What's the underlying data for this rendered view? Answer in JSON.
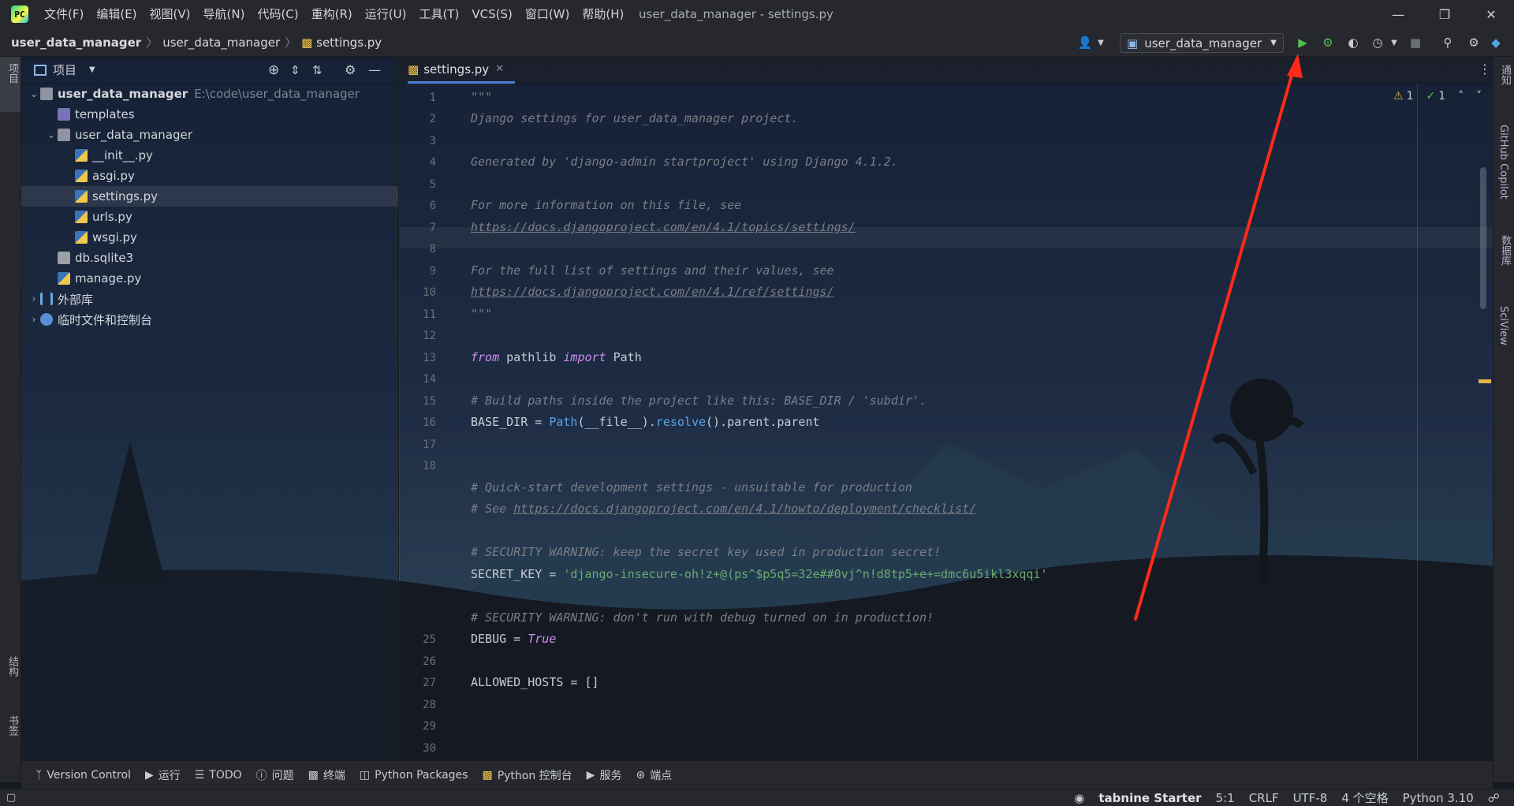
{
  "titlebar": {
    "menu": [
      "文件(F)",
      "编辑(E)",
      "视图(V)",
      "导航(N)",
      "代码(C)",
      "重构(R)",
      "运行(U)",
      "工具(T)",
      "VCS(S)",
      "窗口(W)",
      "帮助(H)"
    ],
    "window_title": "user_data_manager - settings.py"
  },
  "navbar": {
    "crumb_project": "user_data_manager",
    "crumb_package": "user_data_manager",
    "crumb_file": "settings.py",
    "run_config": "user_data_manager"
  },
  "left_stripe": {
    "project": "项目",
    "structure": "结构",
    "bookmarks": "书签"
  },
  "project_panel": {
    "header": "项目",
    "tree": [
      {
        "label": "user_data_manager",
        "hint": "E:\\code\\user_data_manager"
      },
      {
        "label": "templates"
      },
      {
        "label": "user_data_manager"
      },
      {
        "label": "__init__.py"
      },
      {
        "label": "asgi.py"
      },
      {
        "label": "settings.py"
      },
      {
        "label": "urls.py"
      },
      {
        "label": "wsgi.py"
      },
      {
        "label": "db.sqlite3"
      },
      {
        "label": "manage.py"
      },
      {
        "label": "外部库"
      },
      {
        "label": "临时文件和控制台"
      }
    ]
  },
  "editor": {
    "tab": "settings.py",
    "warnings": "1",
    "checks": "1",
    "lines": {
      "l1": "\"\"\"",
      "l2": "Django settings for user_data_manager project.",
      "l4": "Generated by 'django-admin startproject' using Django 4.1.2.",
      "l6": "For more information on this file, see",
      "l7": "https://docs.djangoproject.com/en/4.1/topics/settings/",
      "l9": "For the full list of settings and their values, see",
      "l10": "https://docs.djangoproject.com/en/4.1/ref/settings/",
      "l11": "\"\"\"",
      "l13_from": "from",
      "l13_mod": "pathlib",
      "l13_import": "import",
      "l13_name": "Path",
      "l15": "# Build paths inside the project like this: BASE_DIR / 'subdir'.",
      "l16_a": "BASE_DIR = ",
      "l16_fn": "Path",
      "l16_b": "(__file__).",
      "l16_fn2": "resolve",
      "l16_c": "().parent.parent",
      "l19": "# Quick-start development settings - unsuitable for production",
      "l20_a": "# See ",
      "l20_link": "https://docs.djangoproject.com/en/4.1/howto/deployment/checklist/",
      "l22": "# SECURITY WARNING: keep the secret key used in production secret!",
      "l23_a": "SECRET_KEY = ",
      "l23_str": "'django-insecure-oh!z+@(ps^$p5q5=32e##0vj^n!d8tp5+e+=dmc6u5ikl3xqqi'",
      "l25": "# SECURITY WARNING: don't run with debug turned on in production!",
      "l26_a": "DEBUG = ",
      "l26_kw": "True",
      "l28": "ALLOWED_HOSTS = []"
    },
    "line_numbers": [
      "1",
      "2",
      "3",
      "4",
      "5",
      "6",
      "7",
      "8",
      "9",
      "10",
      "11",
      "12",
      "13",
      "14",
      "15",
      "16",
      "17",
      "18",
      "25",
      "26",
      "27",
      "28",
      "29",
      "30"
    ]
  },
  "right_stripe": {
    "notifications": "通知",
    "copilot": "GitHub Copilot",
    "database": "数据库",
    "sciview": "SciView"
  },
  "bottom_tools": [
    "Version Control",
    "运行",
    "TODO",
    "问题",
    "终端",
    "Python Packages",
    "Python 控制台",
    "服务",
    "端点"
  ],
  "statusbar": {
    "tabnine": "tabnine Starter",
    "position": "5:1",
    "line_sep": "CRLF",
    "encoding": "UTF-8",
    "indent": "4 个空格",
    "interpreter": "Python 3.10"
  },
  "colors": {
    "accent": "#4b7fd1",
    "run_green": "#4fc14f",
    "arrow_red": "#ff2a1a"
  }
}
